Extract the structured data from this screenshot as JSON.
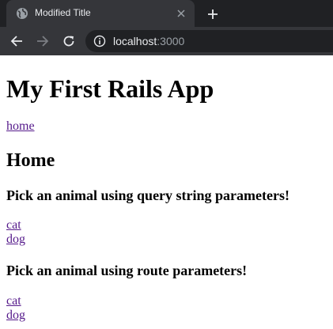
{
  "browser": {
    "tab_title": "Modified Title",
    "url_host": "localhost",
    "url_port": ":3000"
  },
  "page": {
    "app_title": "My First Rails App",
    "home_link": "home",
    "heading": "Home",
    "query_section": {
      "title": "Pick an animal using query string parameters!",
      "links": [
        "cat",
        "dog"
      ]
    },
    "route_section": {
      "title": "Pick an animal using route parameters!",
      "links": [
        "cat",
        "dog"
      ]
    }
  }
}
